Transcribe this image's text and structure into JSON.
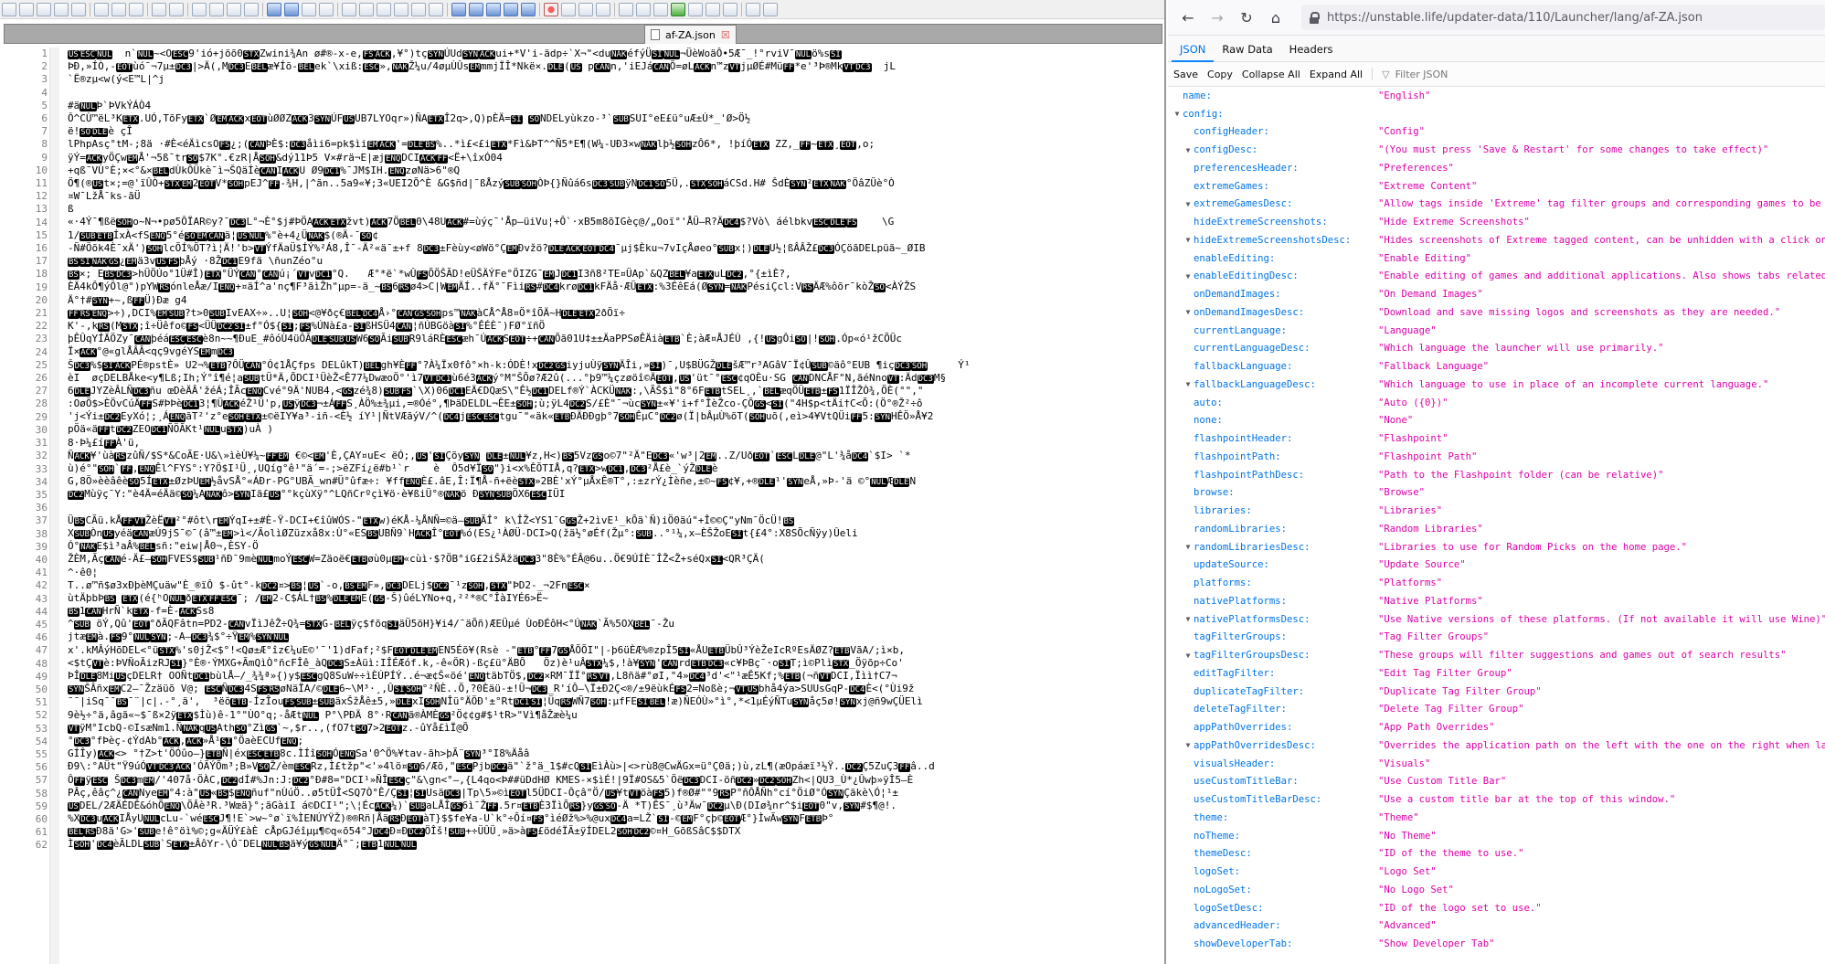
{
  "editor": {
    "tab_name": "af-ZA.json",
    "tab_close": "☒",
    "line_count": 62,
    "lines": [
      "US[ESC]NUL  n`NUL~<]OESC9'ió+jöõ0STXZwini¾An ø#®-x-e,FSACK,¥°)tçSYNÚUd[SYNACKui+*V'i-ädp÷`X]¬\"<duNAKéfýÜSINUL¬ÜèWoäÔ•]5Æ¯_!°rviV¯NULö%sSI",
      "ÞÐ,»ÍÒ,-EOTùó¯¬7µ±DC3|>Ä(,MDC3EBELæ¥Íõ-BELek`\\xiß:[ESC»,NAKŽ¼u/4øµÙÛsEMmmjÏ]Î*Nkë×.DLE(US pCANn,'iEJáCANÕ=øLACKn™zVTjµØÉ#MüFF*e'³Þ®M]kVT[DC3  jL",
      "`Ë®zµ<w(ý<E™L|^j",
      "",
      "#äNULÞ`ÞVkÝÁÒ4",
      "Ô^CÙ™ëL³KETX.UÓ,TõFyETX`ØEMACKxEOTùØØZACK3SYNÚFUSUB7LYOqr»)ÑAETXÎ2q>,Q)pÈÄ=SI SONDELyùkzo-³`SUBSUI°eE£ü°uÆ±Ú*_'Ø>Ö½",
      "ë!SODLEè çÎ",
      "lPhpAsç°tM-;8ä ·#È<éÄìcs[OFS¿;(CANÞÈ$:DC3åìi6=pk$ìiEMACK'=DLEBS%..*ì£<£iETX*Fì&ÞT^^Ñ5*E¶(W¼-UÐ3×wNAKlþ½SOHzÔ6*,] !þíÓETX ZZ,_FF~ETX¸EOT,o;",
      "ÿÝ=ACKyÖÇwEMÅ'¬5ß¯trSO$7K°.€zR|ÅSOH&dý11Þ5 V×#rä¬E|æjENQDCIACKFF<Ë+\\îxÓ04",
      "+qß¯VÙ°È;×<°&×BELdÙkÔÜkè¯ì¬ŠQäÍèCANIACKU Ø9DC1%¯JM$IH.ENQzøNä>6\"®Q",
      "Ö¶(®USt×;=@'ïÛÒ+STXEM2EOT[V*SOHpEJ^FF-¾H,|^ãn..5a9«¥;3«UEI2[Õ^È &G$ñd|¯ßÅzýSUBSOHÒÞ{}Ñûá6sDC3SUBÿNDC1SO5Ü,.STXSOHáCSd.H# ŠdÈSYN²ETXNAK°ÖâZÜè°Ò",
      "¤W¯LžÅ¯ks-ãÜ",
      "ß",
      "«·4Ý¯¶ßëSOHo~N¬•pø5ÔÏA[R©y?¯DC3L°¬È°[$j]#ÞÖAACKETXžvt)ACK7ÖBEL0\\48UACK#=ùýç¯'Åp—üiVu¦+Ô`·xB5m8õIGèç@/„Ooï°'ÅÜ—R?ÄDC4$?V]ò\\ áélbkvESCDLEFS    \\G",
      "1/SUBETBÍxÀ<fSENQ5°éSOEMCANä¦USNUL%\"è+4¿ÜNAK$(®Ä-¯SO¢",
      "-Ñ#Öõk4È¯xÄ')SOHlcÕÍ%ÕT?ì¦Ä!'b>VTÝfÄaÜ[$ÍÝ%²Á8,Î¯-Ä²«ä¯±+f 8DC3±Fèùy<øWö°ÇEMÐvžö?DLEACKEOTDC4¯µj$Èku¬7vIçÅøeo°SUBx¦)DLEU½¦ßÂÂŽ£DC3ÓÇöãDELpüã~_ØIB",
      "BSSINAKGS¿EMä3vUSFSþÅý ·8ŽDC1E9fä \\ñunZéo°u",
      "BS×; EBSDC3>hÜÖÚo°1Ü#Î)ETX]°ÜÝCAN°]CANú¡´VTvDC1°Q.   Æ°*ë`*wÛFSÕÖŠÃD!eÜŠÄÝFe°ÖIZG¯EMJDC1I3ñ8²TE¤ÜAp`&QZBEL¥aETXuLDC2],°{±ìÈ?,",
      "ÈÄ4kÔ¶ýÔl@°)pYWRSónleÅæ/I]ENQ+¤äÍ^a'nç¶F³ãìŽh\"µp=-ä_~BS6RSø4>C|WEMÄÍ..fÄ°¯FìiRS#DC4krøDC1kFÄå·ÆÜETX:%3ÉêEá(ØSYN=NAKPésiÇcl:VRSÄÆ%ôõr¯kòŽSO<ÀÝŽS",
      "Ä°†#SYN+~,ßFFÜ)Ðæ g4",
      "FFRSENQ>÷),DCI%EMSUB?t>0SUBIvEAX÷»..U¦SOH<@¥ðç€BELDC4Å›°CANGSSOHps™NAKàCÅ^Å8¤Ö*îÕÄ~HDLEETX2ðÖï÷",
      "K'-,kRS(MSTX;î÷Üêfo©FS<ÜÜDC2SI±f°Ó${SI;FS%ÚNà£a-SIßHSÜ4CAN¦ñÚBGöàSI%°ÊÉÈ¯)FØ°ïñÖ",
      "þÊÛqYÍÄÖZy¯CANþéáESCESCè8n~~¶ÐuE_#ôóÙ4üÔÃDLESUBUSW6SOÃiSUBR[9láRÈESCæh¯ÚACKSEOT÷+CANÕã01U‡±±ÄaPPSøÊÄiàETB`È;àÆ¤ÅJÉÙ ,{[!USgÔiSO|!SOH.Óp«ó¹žCÕÜ[c",
      "Ï×ACK°@«glÅÂÂ<qç9vgéYSEMmDC3",
      "ŠDC3%$SIACKPÉ®pstÈ» U2¬%ETB?ÔÜCAN°Ó¢1ÅÇfps DELûkT)BELgh¥ÈFF°?À¼Ïx0fô°×h-k:ÓDÈ!xDC2GSiyjuÙÿSYNÄÎi,»SI)¯,U$BÜGŽDLEšÆ™r³AGâV¯Ï¢ÛSUB©äô°EUB ¶içDC3SOH     Ý¹",
      "èI  øçDELBÅke<y¶Lß;Ih;Ý°î¶é¦aSUBtÜ*Ä,ÕDCI¹ÜèŽ<Ê77¼DwæoÖ°'ì7VTDC1ù6é3ACKý°M\"ŠÕø?Æ2û(...°þ9™¼çzøöî©ÄEOT,US'üt¯°ESC¢qOÈu·SG CANDNCÅF\"N,ãéNnoVT:ÄdDC3M§",
      "6DLEJYZèÂL]ÑDC3ñu œDèÄÂ'žéÁ;ÎÃcENQCvé°9Ä'NUB4,<GSzé¾8)SUBFS`\\X)06DC1EÄ€DQæS\\\"Ê½DC1DELf®Ý`ÀCKÜNAK:,\\ÃŠ$ì\"8°6FETBtSEL¸,`BELæqÖÜETB±FS1ÏÎŽÒ¾,ÖÈ(°\",\"",
      ":OøÖ$>ÈÖvCúÄFFS#ÞÞèDC13¦¶[ÜACKéŽ¹Ü'p,USÿDC3¬±ÁFFS¸ÀÖ%±¾µi,=®Óé°,¶ÞäDELDL¬ÊE±SOH;ù;ÿL4DC2S/£È\"¯¬ùcSYN±«¥'i]+f°ÎèŽco-ÇÕGS<SI(\"4H$p<tÄi†C<Õ:(Ö°®Ž²÷ô",
      "'j<Ýi±DC2EyXó¦;¸ÁENQãT²'z°eSOHETX±©ëIY¥a³-iñ-<È½ íY¹|ÑtVÆãýV/^(DC4jESCESCtgu¯\"«äk«ETBÐÄÐÐgþ°7SOHÊµC°DC2ø(Ï|bÂµÙ%õT(SOHuõ(,eì>4¥VtQÜiFF5:SYNHÊÖ»Å¥2",
      "pÖä«äFFtDC2ZEODC1ÑÖÃKt¹NULuSTX)uÀ )",
      "8·Þ¼£íFFÀ'ü,",
      "ÑACK¥'ùàRSzûÑ/]$S*&CoÃE·U&\\»ìèÙ¥¼~FFEM[ €©<EM'È,ÇAY¤uE< ëÓ;,US'SIÇõySYN DLE±NUL¥z,H<)BS5VzGSo©7\"²Ä\"EDC3«'w³|2EM..Z/UðEOT`ESCLDLE@\"L'¾åDC4`$I> `*",
      "ù)é°\"SOH`FF,ENQÊl^FYS°:Y?Ö$I¹Ü¸,UQíg°ê¹\"ä´=-;>ëZFí¿ë#b¹`r    è  Ô5d¥ÏSO\"}i<x%ÊÕTIÅ,q?ETX>wDC1,DC3²Å£è_`ýŽDLEè",
      "G,8Ö»èèâêèSO5ÍETX±ØzÞUEM½åvSÅ°«ÁÐr-PG°UBÃ_wn#Ü°ûfæ÷: ¥ffENQÈ£.âE,Î:Ï¶Å-ñ+ëèSTX»2BÈ'xÝ°µÅxÊ®T°,:±z[rÝ¿Ìèñe,±©~FS¢¥,+®DLE¹'SYNeÅ,»Þ-'ä ©°NULÆDLEN",
      "DC2Mùÿç¯Y:\"è4Ä=éÄä©SO¼ANAKô>SYNIä£US°°kçùXÿ°^LQñCrºçì¥ö·è¥ßiÜ°®NAKö ÐSYNSUBÖX6ESCIÜI",
      "",
      "ÜBSCÃü.kÅFFVTŽèËVT²°#ôt\\rEMÝqI+±#È-Ÿ-DCI+€îûWÓS-\"ETXw)éKÅ-¼ÅNÑ=©ä—SUBÃÎ° k\\ÎŽ<YS1¯GGSŽ+2ìvE¹_kÕä`Ñ)iÖ0äú\"+Î©©Ç\"yNm¯ÖcÜ!BS",
      "XSUBÒnUSyéäCANæÚ9jS¯©¯(â™±EM>ì</ÃolìØZüzxå8x:Ù°«ESBSUBÑ9`HACKÎ°EOT%ó(ES¿¹ÀØÜ-DCI>Q(žä½°øÉf(Žµ°:SUB..]°¹¼,x—[ÈŠŽoESIt{£4°:X8SÕcÑÿy)Ûeli",
      "Ó°NAKE$ì³aÂ%BELsñ:\"eiw|Å0¬,ÈSY-Ö",
      "ŽÈM,ÃçCANé-Ä£—SOHFVES$SUB¹ñÐ¯9mèNULmoÝESCW=Zäoë€ETBøù0µEM«cùì·$?ÖB°iG£2iŠÄžäDC33\"8È%°ÉÂ@6u..Ö€9ÚÍÈ¯ÎŽ<Ž+séQxSI<QR³ÇÄ(",
      "^·ê0¦",
      "T..ø™ñ$ø3xÐþèMÇuäw\"È_®ïÔ $-ût°-kDC2¤>BS¦US`-o,BSEMF»,DC3DELj$DC2¯¹zSOH],STX\"ÞD2-_¬2FnESC×",
      "ùtÄþbÞBS ETX(é{ʰONULðETX[FF]ESC¯; /EM2-C$ÁL†BS%DLEEME(GS-Š)ûéLYNo+q,²²*®C°ÎàIYÉ6>Ë~",
      "BS1CANHrÑ`kETX-f=È-ACKSs8",
      "^SUB öÝ,Qû'EOT°ðÃQFâtn=PD2-CANvÏìJê[Ž÷Q¾=STXG-BELÿç$fõqSIäÜ5ö[H}¥i4/¯äÕñ)ÆEÜµé ÙoÐÉôH<°ÚNAK`Ã%5OXBEL¯-Žu",
      "jtæEMà.FS9°NULSYN;-A—DC3¾$°÷ŸEM%SYNNUL",
      "x'.kMÂýHõDEL<°üSTX%'s0jŽ<$°!<Qø±Æ°îz€¼uE©'¯'1)dFaf;²$FEOTDLEEMEN5Éõ¥(Rsè -\"ETB°FF7GSÅÕÕI]\"|-þ6üÈÆ%®zpÎ5SI«ÅU]ETBÜbÛ³ÝèŽeIcRºEsÄØZ?ETBVãA/;ì×b,",
      "<$tÇVTè:ÞVÑoÃ]izRJSI}°È®·ÝMXG+ÃmQìÒ°ñcFÎê_àQDC3S±Àüì:IÎÉÆóf.k,-ê«ÖR)-ßç£ü°ÄBÕ   Öz)è¹uÂSTX¼$,!à¥SYN'CANrdETBDC3«c¥]ÞBç¯·oSIT;ì©PlìSTX_Öÿõp÷Co'",
      "ÞÎDLE8MiUSçDELR† OOÑtDC1bùlÅ—/_¾¾ª»{)y$ESCgQ8SuW÷÷ìÈÚPÍÝ..é¬æ¢Š«öé'ENQtäbTÖ$,DC2×RM¯ÏÏ°RSVT,L8ñä[#°øI,\"4»DC4³d'<\"¹æÊ5Kf;%ETB(¬ñVTDCI,Ïì]ì†C7¬",
      "SYN[ŠÂñxEMC2—¯]Žzäüõ V@; ESCÑDC34SFSRSøNäÏA/©DLE6~\\M]³·¸,Û[SISOH°²ÑÈ..Õ,?0Èäü-±!Ü¬DC3_R'íÔ—\\Ï±Ð2Ç<®/±9ëùkÉFS2=Noßè;¬VTUSbhå4ýa>]SUUsGqP-DC4È<(°Ùi9ž",
      "¯¯|iSq¯¯BS¯¨|c|.-°¸ä',  ³ëõETB-ÍzÎouFSSUB±SUBäxŠžÅê±5,»DLExISOHNÎü°ÄÖÐ'±°Rt]DC1SI¦ÜqRSWÑ7SOH:µfFESIBEL!æ)ÑEÓÙ»°ì°,*<1µÉýÑTuSYNåç5ø!SYNxj@ñ9wÇÜElì",
      "9è½÷°ä,âgã«~$¯ß×2ÿETX$Ìù)ê-1°\"ÙO°q;-åÆtNUL P°\\PÐÄ 8°·RCANã®ÀMÈGS²Ö¢¢g#$]¹tR>\"Vì¶åŽæè¼u",
      "VTÿM°IcbQ]-©IsæNm1.ÑNAKqUSAth[SO°ZìGS`~,$r..,(fO7tSO7>2EOTz.-ûYå£ìÏ@Õ",
      "°DC3°fÞèç-¢ÝdAb°ACK,ACK»Å¹SI°ÖaèECUfENQ;",
      "GÍÎy)ACK<> °†Z>t'ÖÓûo—}ETBÑ|éxESCETB8c.ÌÍîSOHÓENQSa'0^Ö%¥tav-ãh>þÃ¨SYN³°I8%Äåâ",
      "Ð9\\:°AÜt\"Ÿ9úÓVTDC3ACK'ÓÃÝÕm³;B»VSOŽ/èmESCRz,Ì£tžp\"<'»4lö¤SO6/Æõ,\"ESCPjbDC2ä\"`ž°ä_1$#cQSIEìÀù>|<>rù8]@CwÄGx=ü°Ç0ä;)ù,zL¶(æOpáæï³½Ÿ..DC2Ç5ZuÇ3]FFâ..d",
      "ÔFFÿESC ŠDC3mEM/'407å·ÖÀC,DC2dÍ#%Jn:J:DC2°Ð#8=\"DCI¹»ÑÎESCç\"&\\gn<°—,{L4qo<Þ##üDdHØ KMES-×$ìÉ!|9Ï#OS&5`ÖëDC3DCI-öñDC2»DC2SOHZh<|QU3_Ù*¿Ûwþ»ÿÎ5—È",
      "PÂç,êâç^¿CANNyeEM°4:à\"US«BS$ENQñuf\"nÙúÖ..ø5tÜÎ<SQ7Ò°Ê/ÇSI¦SIUsäDC3|Tp\\5»©ìEOTl5ÜDCI-Ôçâ\"Ö/US¥tVTöàFS5)f®Ø#\"°9RSP°ñÔÅÑh°cí°ÖiØ°ÓSYNÇäkè\\Ó¦¹±",
      "USDEL/2ÆÄÉDÊ&óhÕENQ\\ÕÂè³R.³Wœä}°;ãGàiI á©DCI¹\";\\¦ÉcACK¼)`SUBaLÅÎGS6ì¯ŽFF.5r¤ETBÈ3ÏìÕRS}yGSSO-Ä[ *T)ÊS¯¸ù³Äw¯DC2µ\\Ð(DIø¾nr^$iEOT0\"v,SYN#$¶@!.",
      "%XDC3uACKIÅyUNULcLu-`wéESCJ¶!E`>w~°ø`ï%ÌENÚYŸŽ)®®Rñ|ÅäRSÐEOTàT}$$fe¥a-U`k°÷Õí¤FS°ìéØž%>%@uxDC4a=LŽ`SI-©EMF°çþ©EOTÆ°}ÌwÃwSYNFETBÞ°",
      "BELRSÐ8ä'G>'SUBe!ê°öì%©;g«ÄÜÝ£àÈ cÅpGJéîµµ¶©q«õ54°JDC4Ð¤ÐDC2Ö[Îš!SUB+÷ÜÛÜ[¸»ä>àFS£ödéÏÃ±ÿÍDEL2SOHDC2©¤H_GõßSâC$$DTX",
      "ÌSOH'DC4èÃLDLSUB`SETX±ÂôYr-\\Ó¯DELNULBSä¥ýGSNULÄ°¯;ETB1]NULNUL"
    ]
  },
  "browser": {
    "url": "https://unstable.life/updater-data/110/Launcher/lang/af-ZA.json",
    "icons": [
      "back-icon",
      "forward-icon",
      "reload-icon",
      "home-icon",
      "lock-icon"
    ],
    "tabs": [
      "JSON",
      "Raw Data",
      "Headers"
    ],
    "toolbar": [
      "Save",
      "Copy",
      "Collapse All",
      "Expand All"
    ],
    "filter_placeholder": "Filter JSON",
    "rows": [
      {
        "key": "name:",
        "value": "\"English\"",
        "level": 0,
        "arrow": false
      },
      {
        "key": "config:",
        "value": "",
        "level": 0,
        "arrow": true
      },
      {
        "key": "configHeader:",
        "value": "\"Config\"",
        "level": 1,
        "arrow": false
      },
      {
        "key": "configDesc:",
        "value": "\"(You must press 'Save & Restart' for some changes to take effect)\"",
        "level": 1,
        "arrow": true
      },
      {
        "key": "preferencesHeader:",
        "value": "\"Preferences\"",
        "level": 1,
        "arrow": false
      },
      {
        "key": "extremeGames:",
        "value": "\"Extreme Content\"",
        "level": 1,
        "arrow": false
      },
      {
        "key": "extremeGamesDesc:",
        "value": "\"Allow tags inside 'Extreme' tag filter groups and corresponding games to be shown.\"",
        "level": 1,
        "arrow": true
      },
      {
        "key": "hideExtremeScreenshots:",
        "value": "\"Hide Extreme Screenshots\"",
        "level": 1,
        "arrow": false
      },
      {
        "key": "hideExtremeScreenshotsDesc:",
        "value": "\"Hides screenshots of Extreme tagged content, can be unhidden with a click on the image box.\"",
        "level": 1,
        "arrow": true
      },
      {
        "key": "enableEditing:",
        "value": "\"Enable Editing\"",
        "level": 1,
        "arrow": false
      },
      {
        "key": "enableEditingDesc:",
        "value": "\"Enable editing of games and additional applications. Also shows tabs related to editing.\"",
        "level": 1,
        "arrow": true
      },
      {
        "key": "onDemandImages:",
        "value": "\"On Demand Images\"",
        "level": 1,
        "arrow": false
      },
      {
        "key": "onDemandImagesDesc:",
        "value": "\"Download and save missing logos and screenshots as they are needed.\"",
        "level": 1,
        "arrow": true
      },
      {
        "key": "currentLanguage:",
        "value": "\"Language\"",
        "level": 1,
        "arrow": false
      },
      {
        "key": "currentLanguageDesc:",
        "value": "\"Which language the launcher will use primarily.\"",
        "level": 1,
        "arrow": false
      },
      {
        "key": "fallbackLanguage:",
        "value": "\"Fallback Language\"",
        "level": 1,
        "arrow": false
      },
      {
        "key": "fallbackLanguageDesc:",
        "value": "\"Which language to use in place of an incomplete current language.\"",
        "level": 1,
        "arrow": true
      },
      {
        "key": "auto:",
        "value": "\"Auto ({0})\"",
        "level": 1,
        "arrow": false
      },
      {
        "key": "none:",
        "value": "\"None\"",
        "level": 1,
        "arrow": false
      },
      {
        "key": "flashpointHeader:",
        "value": "\"Flashpoint\"",
        "level": 1,
        "arrow": false
      },
      {
        "key": "flashpointPath:",
        "value": "\"Flashpoint Path\"",
        "level": 1,
        "arrow": false
      },
      {
        "key": "flashpointPathDesc:",
        "value": "\"Path to the Flashpoint folder (can be relative)\"",
        "level": 1,
        "arrow": false
      },
      {
        "key": "browse:",
        "value": "\"Browse\"",
        "level": 1,
        "arrow": false
      },
      {
        "key": "libraries:",
        "value": "\"Libraries\"",
        "level": 1,
        "arrow": false
      },
      {
        "key": "randomLibraries:",
        "value": "\"Random Libraries\"",
        "level": 1,
        "arrow": false
      },
      {
        "key": "randomLibrariesDesc:",
        "value": "\"Libraries to use for Random Picks on the home page.\"",
        "level": 1,
        "arrow": true
      },
      {
        "key": "updateSource:",
        "value": "\"Update Source\"",
        "level": 1,
        "arrow": false
      },
      {
        "key": "platforms:",
        "value": "\"Platforms\"",
        "level": 1,
        "arrow": false
      },
      {
        "key": "nativePlatforms:",
        "value": "\"Native Platforms\"",
        "level": 1,
        "arrow": false
      },
      {
        "key": "nativePlatformsDesc:",
        "value": "\"Use Native versions of these platforms. (If not available it will use Wine)\"",
        "level": 1,
        "arrow": true
      },
      {
        "key": "tagFilterGroups:",
        "value": "\"Tag Filter Groups\"",
        "level": 1,
        "arrow": false
      },
      {
        "key": "tagFilterGroupsDesc:",
        "value": "\"These groups will filter suggestions and games out of search results\"",
        "level": 1,
        "arrow": true
      },
      {
        "key": "editTagFilter:",
        "value": "\"Edit Tag Filter Group\"",
        "level": 1,
        "arrow": false
      },
      {
        "key": "duplicateTagFilter:",
        "value": "\"Duplicate Tag Filter Group\"",
        "level": 1,
        "arrow": false
      },
      {
        "key": "deleteTagFilter:",
        "value": "\"Delete Tag Filter Group\"",
        "level": 1,
        "arrow": false
      },
      {
        "key": "appPathOverrides:",
        "value": "\"App Path Overrides\"",
        "level": 1,
        "arrow": false
      },
      {
        "key": "appPathOverridesDesc:",
        "value": "\"Overrides the application path on the left with the one on the right when launching games.\"",
        "level": 1,
        "arrow": true
      },
      {
        "key": "visualsHeader:",
        "value": "\"Visuals\"",
        "level": 1,
        "arrow": false
      },
      {
        "key": "useCustomTitleBar:",
        "value": "\"Use Custom Title Bar\"",
        "level": 1,
        "arrow": false
      },
      {
        "key": "useCustomTitleBarDesc:",
        "value": "\"Use a custom title bar at the top of this window.\"",
        "level": 1,
        "arrow": false
      },
      {
        "key": "theme:",
        "value": "\"Theme\"",
        "level": 1,
        "arrow": false
      },
      {
        "key": "noTheme:",
        "value": "\"No Theme\"",
        "level": 1,
        "arrow": false
      },
      {
        "key": "themeDesc:",
        "value": "\"ID of the theme to use.\"",
        "level": 1,
        "arrow": false
      },
      {
        "key": "logoSet:",
        "value": "\"Logo Set\"",
        "level": 1,
        "arrow": false
      },
      {
        "key": "noLogoSet:",
        "value": "\"No Logo Set\"",
        "level": 1,
        "arrow": false
      },
      {
        "key": "logoSetDesc:",
        "value": "\"ID of the logo set to use.\"",
        "level": 1,
        "arrow": false
      },
      {
        "key": "advancedHeader:",
        "value": "\"Advanced\"",
        "level": 1,
        "arrow": false
      },
      {
        "key": "showDeveloperTab:",
        "value": "\"Show Developer Tab\"",
        "level": 1,
        "arrow": false
      }
    ]
  }
}
